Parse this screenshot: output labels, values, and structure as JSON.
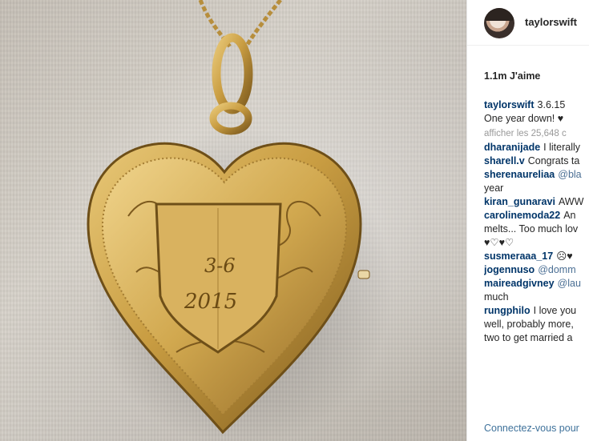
{
  "profile": {
    "username": "taylorswift"
  },
  "likes_label": "1.1m J'aime",
  "caption": {
    "username": "taylorswift",
    "line1": "3.6.15",
    "line2": "One year down! ♥"
  },
  "more_comments": "afficher les 25,648 c",
  "comments": [
    {
      "user": "dharanijade",
      "text": "I literally"
    },
    {
      "user": "sharell.v",
      "text": "Congrats ta"
    },
    {
      "user": "sherenaureliaa",
      "mention": "@bla",
      "text2": "year"
    },
    {
      "user": "kiran_gunaravi",
      "text": "AWW"
    },
    {
      "user": "carolinemoda22",
      "text": "An",
      "text2": "melts... Too much lov",
      "text3": "♥♡♥♡"
    },
    {
      "user": "susmeraaa_17",
      "text": "☹♥"
    },
    {
      "user": "jogennuso",
      "mention": "@domm"
    },
    {
      "user": "maireadgivney",
      "mention": "@lau",
      "text2": "much"
    },
    {
      "user": "rungphilo",
      "text": "I love you",
      "text2": "well, probably more,",
      "text3": "two to get married a"
    }
  ],
  "login_link": "Connectez-vous pour",
  "photo": {
    "engraving_line1": "3-6",
    "engraving_line2": "2015",
    "colors": {
      "gold": "#c9a24c",
      "gold_dark": "#8a6a25",
      "sweater": "#cfc9c1"
    }
  }
}
